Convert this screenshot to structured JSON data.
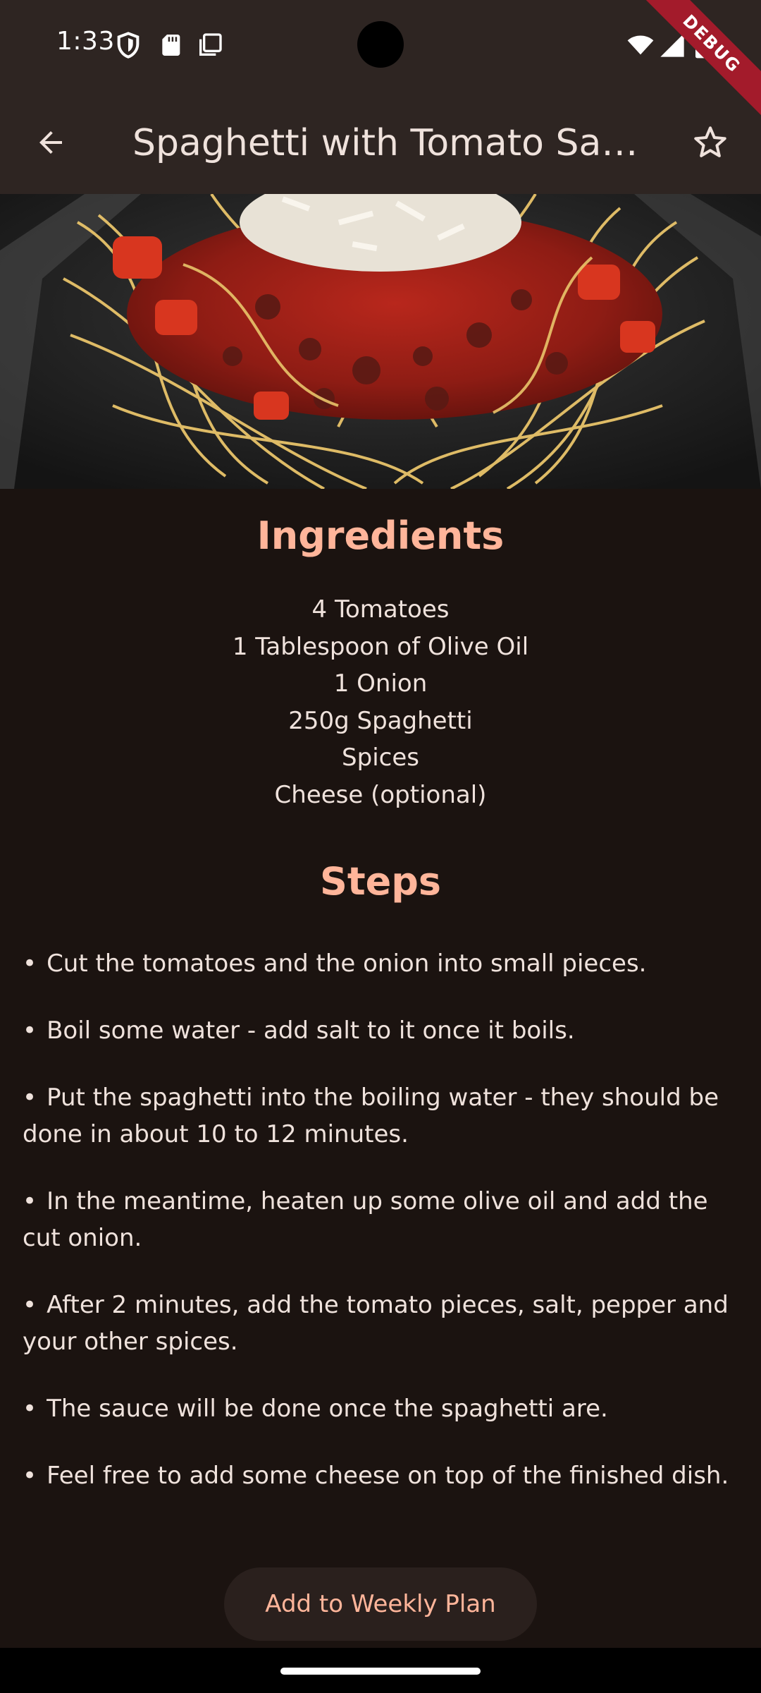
{
  "status_bar": {
    "time": "1:33",
    "left_icons": [
      "shield-icon",
      "sd-card-icon",
      "screenshot-icon"
    ],
    "right_icons": [
      "wifi-icon",
      "signal-icon",
      "battery-icon"
    ]
  },
  "debug_banner": "DEBUG",
  "app_bar": {
    "title": "Spaghetti with Tomato Sauce",
    "back_icon": "arrow-back-icon",
    "favorite_icon": "star-outline-icon"
  },
  "hero_image": {
    "alt": "Spaghetti with tomato sauce and grated cheese"
  },
  "ingredients": {
    "heading": "Ingredients",
    "items": [
      "4 Tomatoes",
      "1 Tablespoon of Olive Oil",
      "1 Onion",
      "250g Spaghetti",
      "Spices",
      "Cheese (optional)"
    ]
  },
  "steps": {
    "heading": "Steps",
    "bullet": "•",
    "items": [
      "Cut the tomatoes and the onion into small pieces.",
      "Boil some water - add salt to it once it boils.",
      "Put the spaghetti into the boiling water - they should be done in about 10 to 12 minutes.",
      "In the meantime, heaten up some olive oil and add the cut onion.",
      "After 2 minutes, add the tomato pieces, salt, pepper and your other spices.",
      "The sauce will be done once the spaghetti are.",
      "Feel free to add some cheese on top of the finished dish."
    ]
  },
  "actions": {
    "add_to_plan_label": "Add to Weekly Plan"
  },
  "colors": {
    "background": "#1b1310",
    "app_bar": "#2e2522",
    "accent": "#ffb59a",
    "text": "#efe2dc",
    "button_bg": "#2a201d",
    "debug_banner": "#a31b2b"
  }
}
